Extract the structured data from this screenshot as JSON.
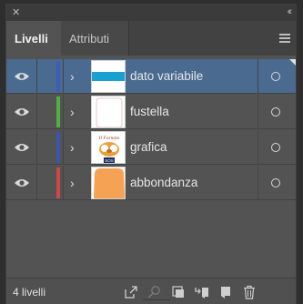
{
  "titlebar": {
    "close_icon": "close-icon",
    "collapse_icon": "collapse-panel-icon"
  },
  "tabs": [
    {
      "label": "Livelli",
      "active": true
    },
    {
      "label": "Attributi",
      "active": false
    }
  ],
  "layers": [
    {
      "name": "dato variabile",
      "color": "#3f5db8",
      "selected": true,
      "thumb": "blue-band"
    },
    {
      "name": "fustella",
      "color": "#4fb041",
      "selected": false,
      "thumb": "outline"
    },
    {
      "name": "grafica",
      "color": "#3a55b0",
      "selected": false,
      "thumb": "logo"
    },
    {
      "name": "abbondanza",
      "color": "#d04848",
      "selected": false,
      "thumb": "orange-shape"
    }
  ],
  "footer": {
    "count_label": "4 livelli",
    "buttons": [
      "export-icon",
      "locate-object-icon",
      "clipping-mask-icon",
      "new-sublayer-icon",
      "new-layer-icon",
      "trash-icon"
    ]
  },
  "thumb_texts": {
    "logo_top": "Il Fornaio",
    "logo_bottom": "SOS"
  },
  "colors": {
    "selection": "#4a6a90",
    "panel": "#535353",
    "thumb_blue": "#1aa0d0",
    "thumb_orange": "#f5a254"
  }
}
